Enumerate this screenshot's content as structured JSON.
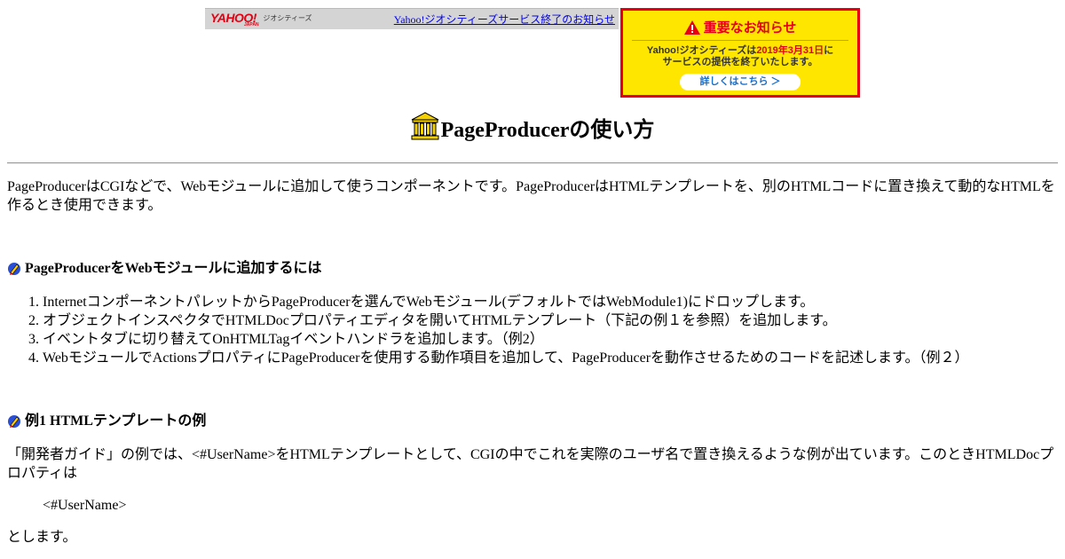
{
  "geocities_bar": {
    "logo_word": "YAHOO!",
    "logo_sub": "JAPAN",
    "service_name": "ジオシティーズ",
    "end_notice_link": "Yahoo!ジオシティーズサービス終了のお知らせ"
  },
  "notice_banner": {
    "title": "重要なお知らせ",
    "line1_pre": "Yahoo!ジオシティーズは",
    "line1_date": "2019年3月31日",
    "line1_post": "に",
    "line2": "サービスの提供を終了いたします。",
    "button": "詳しくはこちら ＞",
    "colors": {
      "background": "#ffe600",
      "border": "#e60012",
      "accent": "#e60012",
      "button_text": "#1a6fc9"
    }
  },
  "page": {
    "title": "PageProducerの使い方",
    "title_icon": "bank-building-icon",
    "intro": "PageProducerはCGIなどで、Webモジュールに追加して使うコンポーネントです。PageProducerはHTMLテンプレートを、別のHTMLコードに置き換えて動的なHTMLを作るとき使用できます。"
  },
  "section1": {
    "icon": "pencil-bullet-icon",
    "heading": "PageProducerをWebモジュールに追加するには",
    "steps": [
      "InternetコンポーネントパレットからPageProducerを選んでWebモジュール(デフォルトではWebModule1)にドロップします。",
      "オブジェクトインスペクタでHTMLDocプロパティエディタを開いてHTMLテンプレート（下記の例１を参照）を追加します。",
      "イベントタブに切り替えてOnHTMLTagイベントハンドラを追加します。（例2）",
      "WebモジュールでActionsプロパティにPageProducerを使用する動作項目を追加して、PageProducerを動作させるためのコードを記述します。（例２）"
    ]
  },
  "section2": {
    "icon": "pencil-bullet-icon",
    "heading": "例1 HTMLテンプレートの例",
    "text": "「開発者ガイド」の例では、<#UserName>をHTMLテンプレートとして、CGIの中でこれを実際のユーザ名で置き換えるような例が出ています。このときHTMLDocプロパティは",
    "code": "<#UserName>",
    "closing": "とします。"
  }
}
